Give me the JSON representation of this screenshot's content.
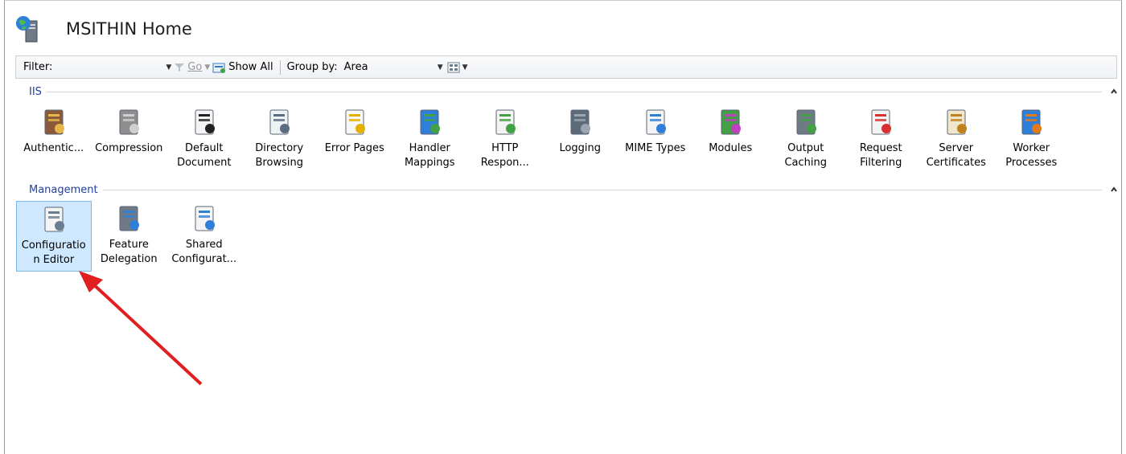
{
  "header": {
    "title": "MSITHIN Home",
    "icon": "server-globe-icon"
  },
  "toolbar": {
    "filter_label": "Filter:",
    "filter_value": "",
    "go_label": "Go",
    "show_all_label": "Show All",
    "group_by_label": "Group by:",
    "group_by_value": "Area"
  },
  "sections": [
    {
      "label": "IIS",
      "items": [
        {
          "label": "Authentic...",
          "icon": "user-lock-icon"
        },
        {
          "label": "Compression",
          "icon": "compression-clamp-icon"
        },
        {
          "label": "Default Document",
          "icon": "document-check-icon"
        },
        {
          "label": "Directory Browsing",
          "icon": "directory-browse-icon"
        },
        {
          "label": "Error Pages",
          "icon": "error-404-icon"
        },
        {
          "label": "Handler Mappings",
          "icon": "handler-arrows-icon"
        },
        {
          "label": "HTTP Respon...",
          "icon": "http-response-icon"
        },
        {
          "label": "Logging",
          "icon": "log-notebook-icon"
        },
        {
          "label": "MIME Types",
          "icon": "mime-types-icon"
        },
        {
          "label": "Modules",
          "icon": "modules-icon"
        },
        {
          "label": "Output Caching",
          "icon": "output-caching-icon"
        },
        {
          "label": "Request Filtering",
          "icon": "request-filtering-icon"
        },
        {
          "label": "Server Certificates",
          "icon": "certificate-icon"
        },
        {
          "label": "Worker Processes",
          "icon": "worker-processes-icon"
        }
      ]
    },
    {
      "label": "Management",
      "items": [
        {
          "label": "Configuratio n Editor",
          "icon": "config-editor-icon",
          "selected": true
        },
        {
          "label": "Feature Delegation",
          "icon": "feature-delegation-icon"
        },
        {
          "label": "Shared Configurat...",
          "icon": "shared-config-icon"
        }
      ]
    }
  ],
  "colors": {
    "section_label": "#1f3fa0",
    "selection_bg": "#cde8ff",
    "annotation_arrow": "#e02020"
  }
}
